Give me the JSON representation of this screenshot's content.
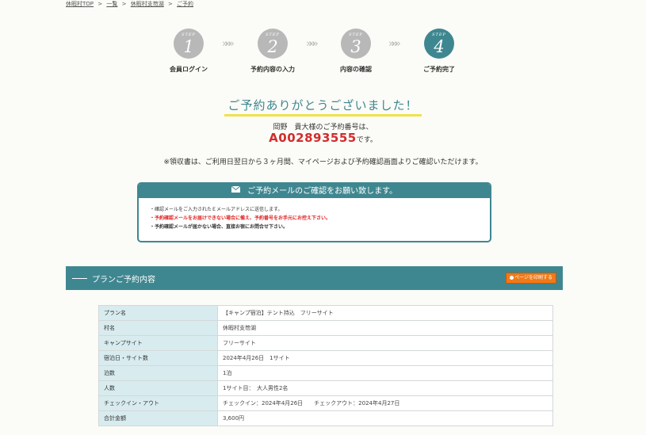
{
  "breadcrumb": {
    "items": [
      "休暇村TOP",
      "一覧",
      "休暇村支笏湖",
      "ご予約"
    ],
    "separator": ">"
  },
  "steps": {
    "label": "STEP",
    "items": [
      {
        "num": "1",
        "caption": "会員ログイン"
      },
      {
        "num": "2",
        "caption": "予約内容の入力"
      },
      {
        "num": "3",
        "caption": "内容の確認"
      },
      {
        "num": "4",
        "caption": "ご予約完了"
      }
    ],
    "arrow": "»»»"
  },
  "thanks": {
    "title": "ご予約ありがとうございました！",
    "customer_line": "岡野　貴大様のご予約番号は、",
    "reservation_no": "A002893555",
    "reservation_suffix": "です。",
    "receipt_note": "※領収書は、ご利用日翌日から３ヶ月間、マイページおよび予約確認画面よりご確認いただけます。"
  },
  "mail_notice": {
    "title": "ご予約メールのご確認をお願い致します。",
    "lines": [
      "・確認メールをご入力されたＥメールアドレスに送信します。",
      "・予約確認メールをお届けできない場合に備え、予約番号をお手元にお控え下さい。",
      "・予約確認メールが届かない場合、直接お宿にお問合せ下さい。"
    ]
  },
  "plan": {
    "section_title": "プランご予約内容",
    "print_button": "ページを印刷する",
    "rows": [
      {
        "label": "プラン名",
        "value": "【キャンプ宿泊】テント持込　フリーサイト"
      },
      {
        "label": "村名",
        "value": "休暇村支笏湖"
      },
      {
        "label": "キャンプサイト",
        "value": "フリーサイト"
      },
      {
        "label": "宿泊日・サイト数",
        "value": "2024年4月26日　1サイト"
      },
      {
        "label": "泊数",
        "value": "1泊"
      },
      {
        "label": "人数",
        "value": "1サイト目：　大人男性2名"
      },
      {
        "label": "チェックイン・アウト",
        "value": "チェックイン：2024年4月26日　　チェックアウト：2024年4月27日"
      },
      {
        "label": "合計金額",
        "value": "3,600円"
      }
    ]
  },
  "colors": {
    "accent": "#3f8790",
    "inactive_step": "#b8b8b8",
    "reservation_no": "#d22c2c",
    "print_button": "#ef7a1a",
    "highlight": "#f0e24e",
    "warning_text": "#e02222"
  }
}
